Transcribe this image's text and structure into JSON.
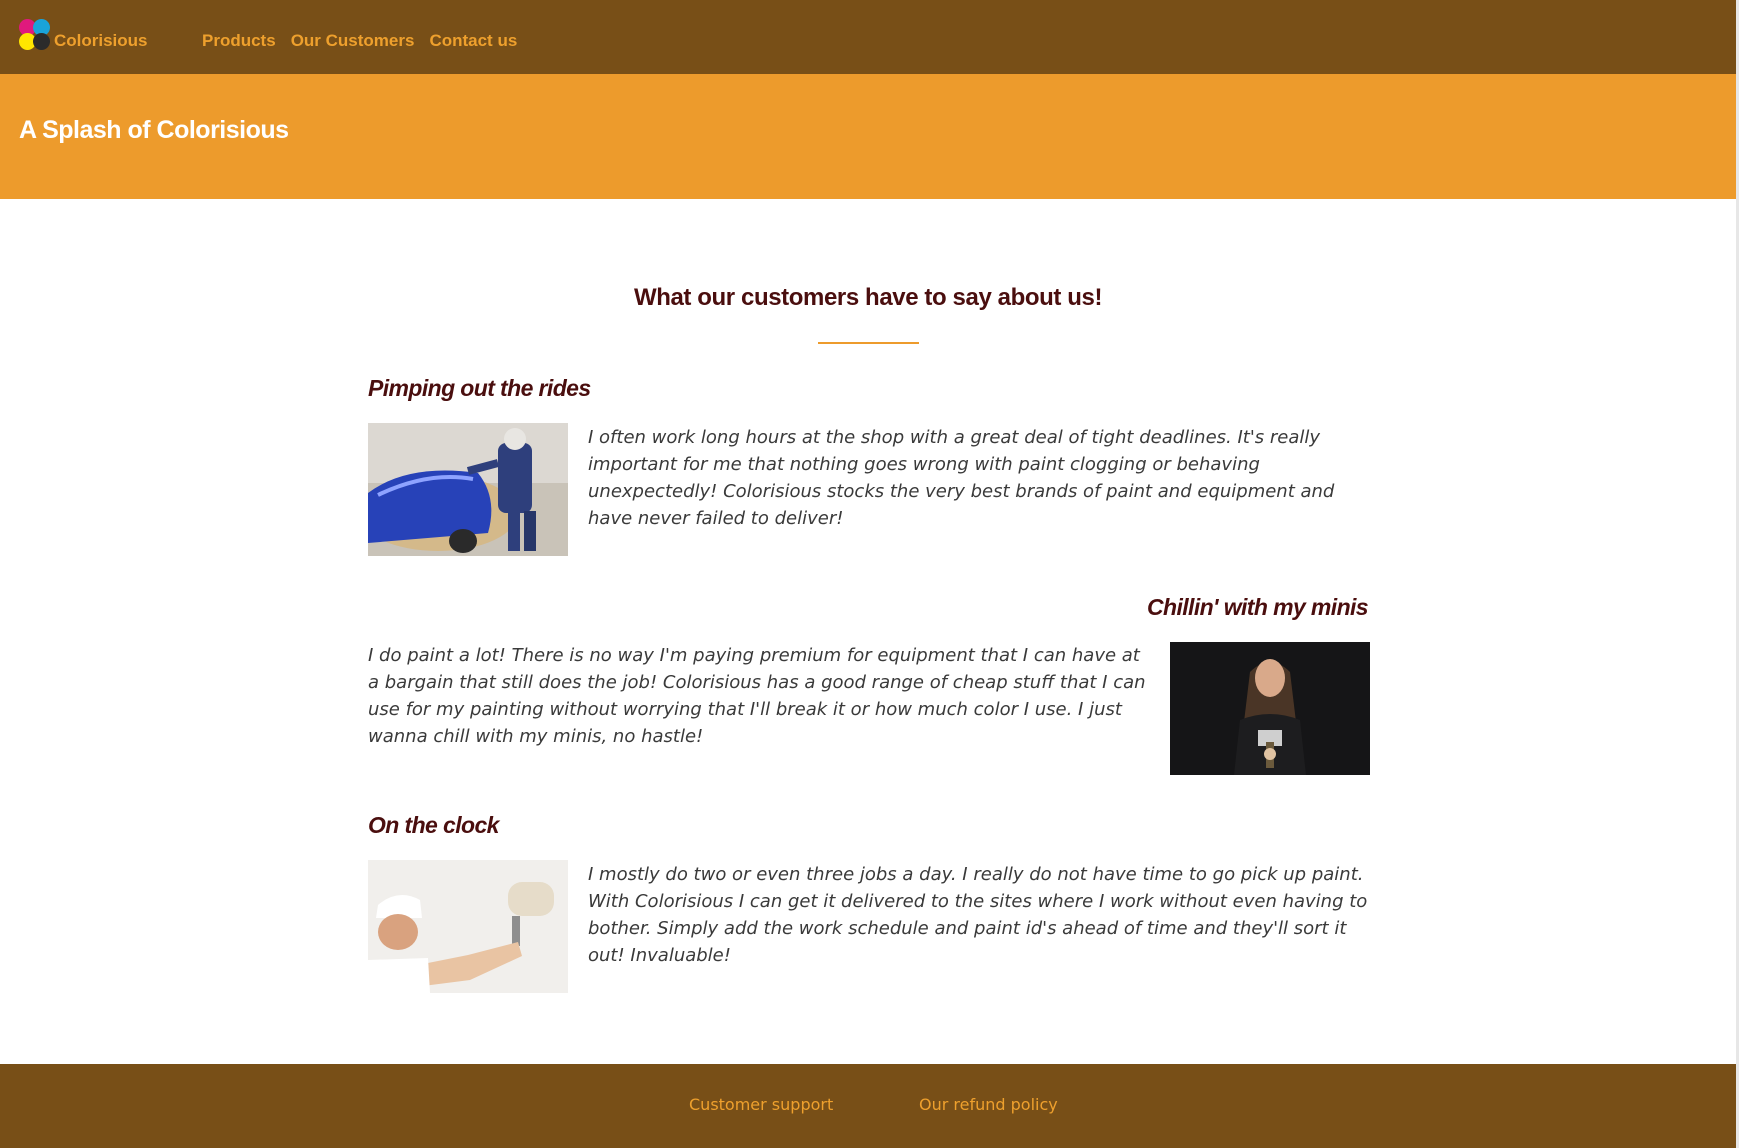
{
  "brand": {
    "name": "Colorisious",
    "logo_colors": [
      "#e0197d",
      "#1aa3d9",
      "#ffe600",
      "#2b2b2b"
    ]
  },
  "nav": {
    "links": [
      "Products",
      "Our Customers",
      "Contact us"
    ]
  },
  "hero": {
    "title": "A Splash of Colorisious"
  },
  "main": {
    "section_title": "What our customers have to say about us!",
    "testimonials": [
      {
        "heading": "Pimping out the rides",
        "text": "I often work long hours at the shop with a great deal of tight deadlines. It's really important for me that nothing goes wrong with paint clogging or behaving unexpectedly! Colorisious stocks the very best brands of paint and equipment and have never failed to deliver!",
        "image": "car-painter-photo"
      },
      {
        "heading": "Chillin' with my minis",
        "text": "I do paint a lot! There is no way I'm paying premium for equipment that I can have at a bargain that still does the job! Colorisious has a good range of cheap stuff that I can use for my painting without worrying that I'll break it or how much color I use. I just wanna chill with my minis, no hastle!",
        "image": "miniature-painter-photo"
      },
      {
        "heading": "On the clock",
        "text": "I mostly do two or even three jobs a day. I really do not have time to go pick up paint. With Colorisious I can get it delivered to the sites where I work without even having to bother. Simply add the work schedule and paint id's ahead of time and they'll sort it out! Invaluable!",
        "image": "wall-painter-photo"
      }
    ]
  },
  "footer": {
    "links": [
      "Customer support",
      "Our refund policy"
    ]
  },
  "colors": {
    "nav_bg": "#784f17",
    "hero_bg": "#ed9b2c",
    "accent_text": "#eea02d",
    "heading_text": "#4a0e0e"
  }
}
